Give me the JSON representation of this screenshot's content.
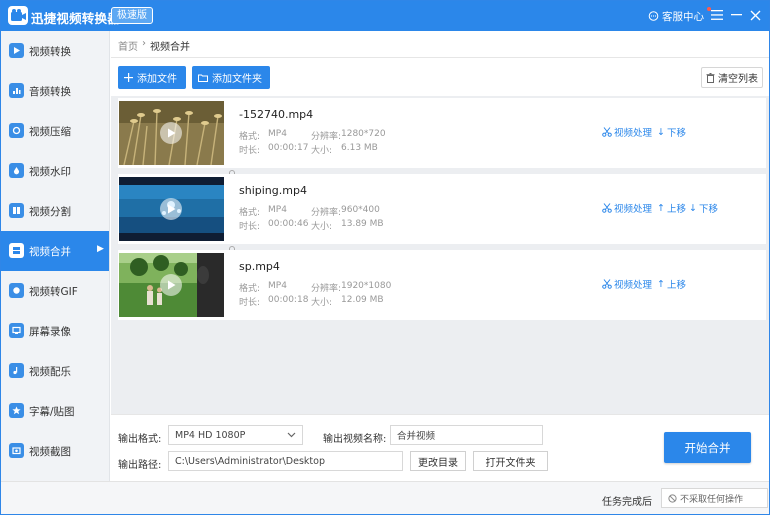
{
  "app": {
    "title": "迅捷视频转换器",
    "badge": "极速版",
    "help_label": "客服中心"
  },
  "colors": {
    "accent": "#2b87ea",
    "sidebar_bg": "#f1f3f6",
    "list_bg": "#eceef1",
    "notify_dot": "#ff5b4f"
  },
  "sidebar": {
    "items": [
      {
        "label": "视频转换",
        "icon": "video-convert-icon"
      },
      {
        "label": "音频转换",
        "icon": "audio-convert-icon"
      },
      {
        "label": "视频压缩",
        "icon": "video-compress-icon"
      },
      {
        "label": "视频水印",
        "icon": "video-watermark-icon"
      },
      {
        "label": "视频分割",
        "icon": "video-split-icon"
      },
      {
        "label": "视频合并",
        "icon": "video-merge-icon",
        "active": true
      },
      {
        "label": "视频转GIF",
        "icon": "video-gif-icon"
      },
      {
        "label": "屏幕录像",
        "icon": "screen-record-icon"
      },
      {
        "label": "视频配乐",
        "icon": "video-music-icon"
      },
      {
        "label": "字幕/贴图",
        "icon": "subtitle-icon"
      },
      {
        "label": "视频截图",
        "icon": "screenshot-icon"
      }
    ]
  },
  "breadcrumb": {
    "home": "首页",
    "sep": "›",
    "current": "视频合并"
  },
  "toolbar": {
    "add_file": "添加文件",
    "add_folder": "添加文件夹",
    "clear": "清空列表"
  },
  "labels": {
    "format": "格式:",
    "resolution": "分辨率:",
    "duration": "时长:",
    "size": "大小:",
    "process": "视频处理",
    "up": "上移",
    "down": "下移"
  },
  "files": [
    {
      "name": "-152740.mp4",
      "format": "MP4",
      "resolution": "1280*720",
      "duration": "00:00:17",
      "size": "6.13 MB"
    },
    {
      "name": "shiping.mp4",
      "format": "MP4",
      "resolution": "960*400",
      "duration": "00:00:46",
      "size": "13.89 MB"
    },
    {
      "name": "sp.mp4",
      "format": "MP4",
      "resolution": "1920*1080",
      "duration": "00:00:18",
      "size": "12.09 MB"
    }
  ],
  "output": {
    "format_label": "输出格式:",
    "format_value": "MP4   HD 1080P",
    "name_label": "输出视频名称:",
    "name_value": "合并视频",
    "path_label": "输出路径:",
    "path_value": "C:\\Users\\Administrator\\Desktop",
    "change_dir": "更改目录",
    "open_folder": "打开文件夹",
    "start": "开始合并"
  },
  "footer": {
    "after_label": "任务完成后",
    "after_value": "不采取任何操作"
  }
}
